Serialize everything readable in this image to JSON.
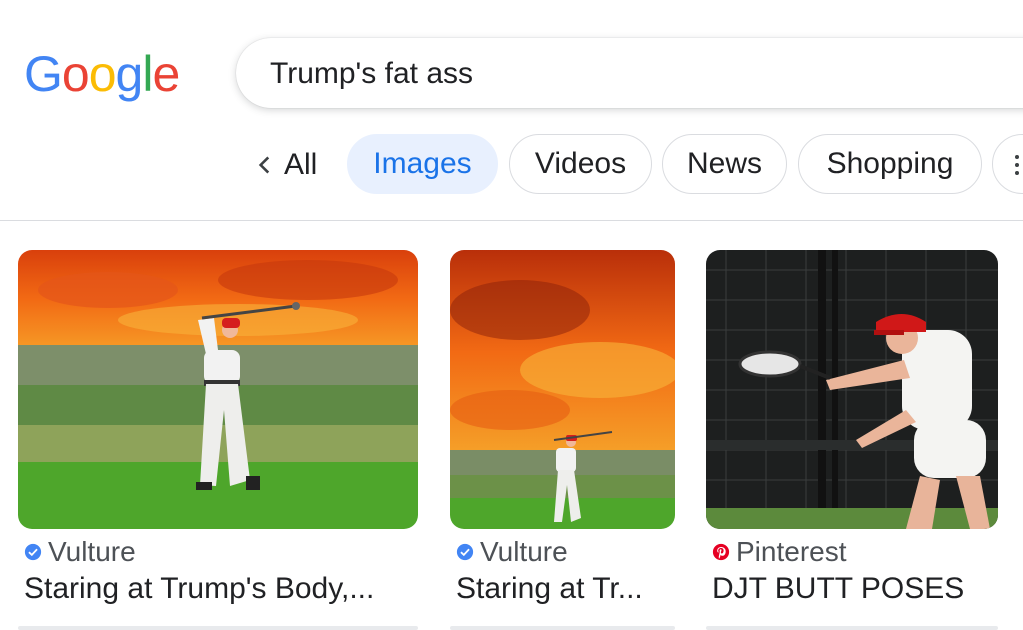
{
  "logo": {
    "letters": [
      "G",
      "o",
      "o",
      "g",
      "l",
      "e"
    ],
    "colors": [
      "#4285F4",
      "#EA4335",
      "#FBBC05",
      "#4285F4",
      "#34A853",
      "#EA4335"
    ]
  },
  "search": {
    "query": "Trump's fat ass"
  },
  "tabs": {
    "all_label": "All",
    "chips": [
      "Images",
      "Videos",
      "News",
      "Shopping"
    ],
    "active": "Images"
  },
  "results": [
    {
      "source": "Vulture",
      "source_icon": "verified-badge-icon",
      "title": "Staring at Trump's Body,..."
    },
    {
      "source": "Vulture",
      "source_icon": "verified-badge-icon",
      "title": "Staring at Tr..."
    },
    {
      "source": "Pinterest",
      "source_icon": "pinterest-icon",
      "title": "DJT BUTT POSES"
    }
  ],
  "colors": {
    "accent": "#1a73e8",
    "active_chip_bg": "#e8f0fe",
    "verified": "#4285F4",
    "pinterest": "#E60023"
  }
}
